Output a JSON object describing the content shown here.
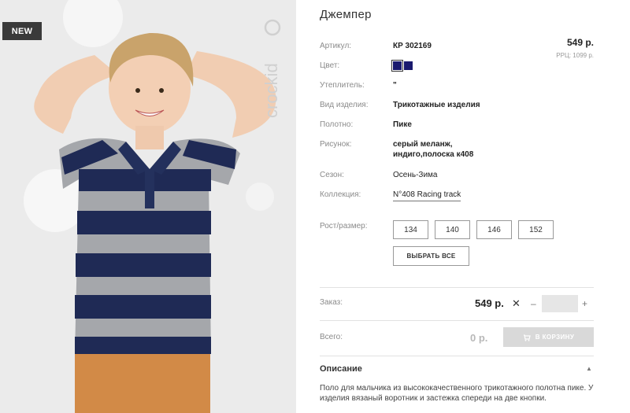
{
  "product": {
    "badge": "NEW",
    "brand_watermark": "crockid",
    "title": "Джемпер",
    "price": "549 р.",
    "rrp": "РРЦ: 1099 р."
  },
  "specs": [
    {
      "label": "Артикул:",
      "value": "КР 302169"
    },
    {
      "label": "Цвет:",
      "value": ""
    },
    {
      "label": "Утеплитель:",
      "value": "\""
    },
    {
      "label": "Вид изделия:",
      "value": "Трикотажные изделия"
    },
    {
      "label": "Полотно:",
      "value": "Пике"
    },
    {
      "label": "Рисунок:",
      "value": "серый меланж,\nиндиго,полоска к408"
    },
    {
      "label": "Сезон:",
      "value": "Осень-Зима"
    },
    {
      "label": "Коллекция:",
      "value": "N°408 Racing track"
    }
  ],
  "colors": {
    "swatch_1": "#1a1a6e",
    "swatch_2": "#1a1a6e"
  },
  "sizes": {
    "label": "Рост/размер:",
    "options": [
      "134",
      "140",
      "146",
      "152"
    ],
    "select_all": "ВЫБРАТЬ ВСЕ"
  },
  "order": {
    "label": "Заказ:",
    "price": "549 р.",
    "multiply": "✕",
    "minus": "–",
    "quantity": "",
    "plus": "+"
  },
  "total": {
    "label": "Всего:",
    "value": "0 р.",
    "cart_button": "В КОРЗИНУ"
  },
  "description": {
    "title": "Описание",
    "chevron": "▲",
    "text": "Поло для мальчика из высококачественного трикотажного полотна пике. У изделия вязаный воротник и застежка спереди на две кнопки."
  }
}
